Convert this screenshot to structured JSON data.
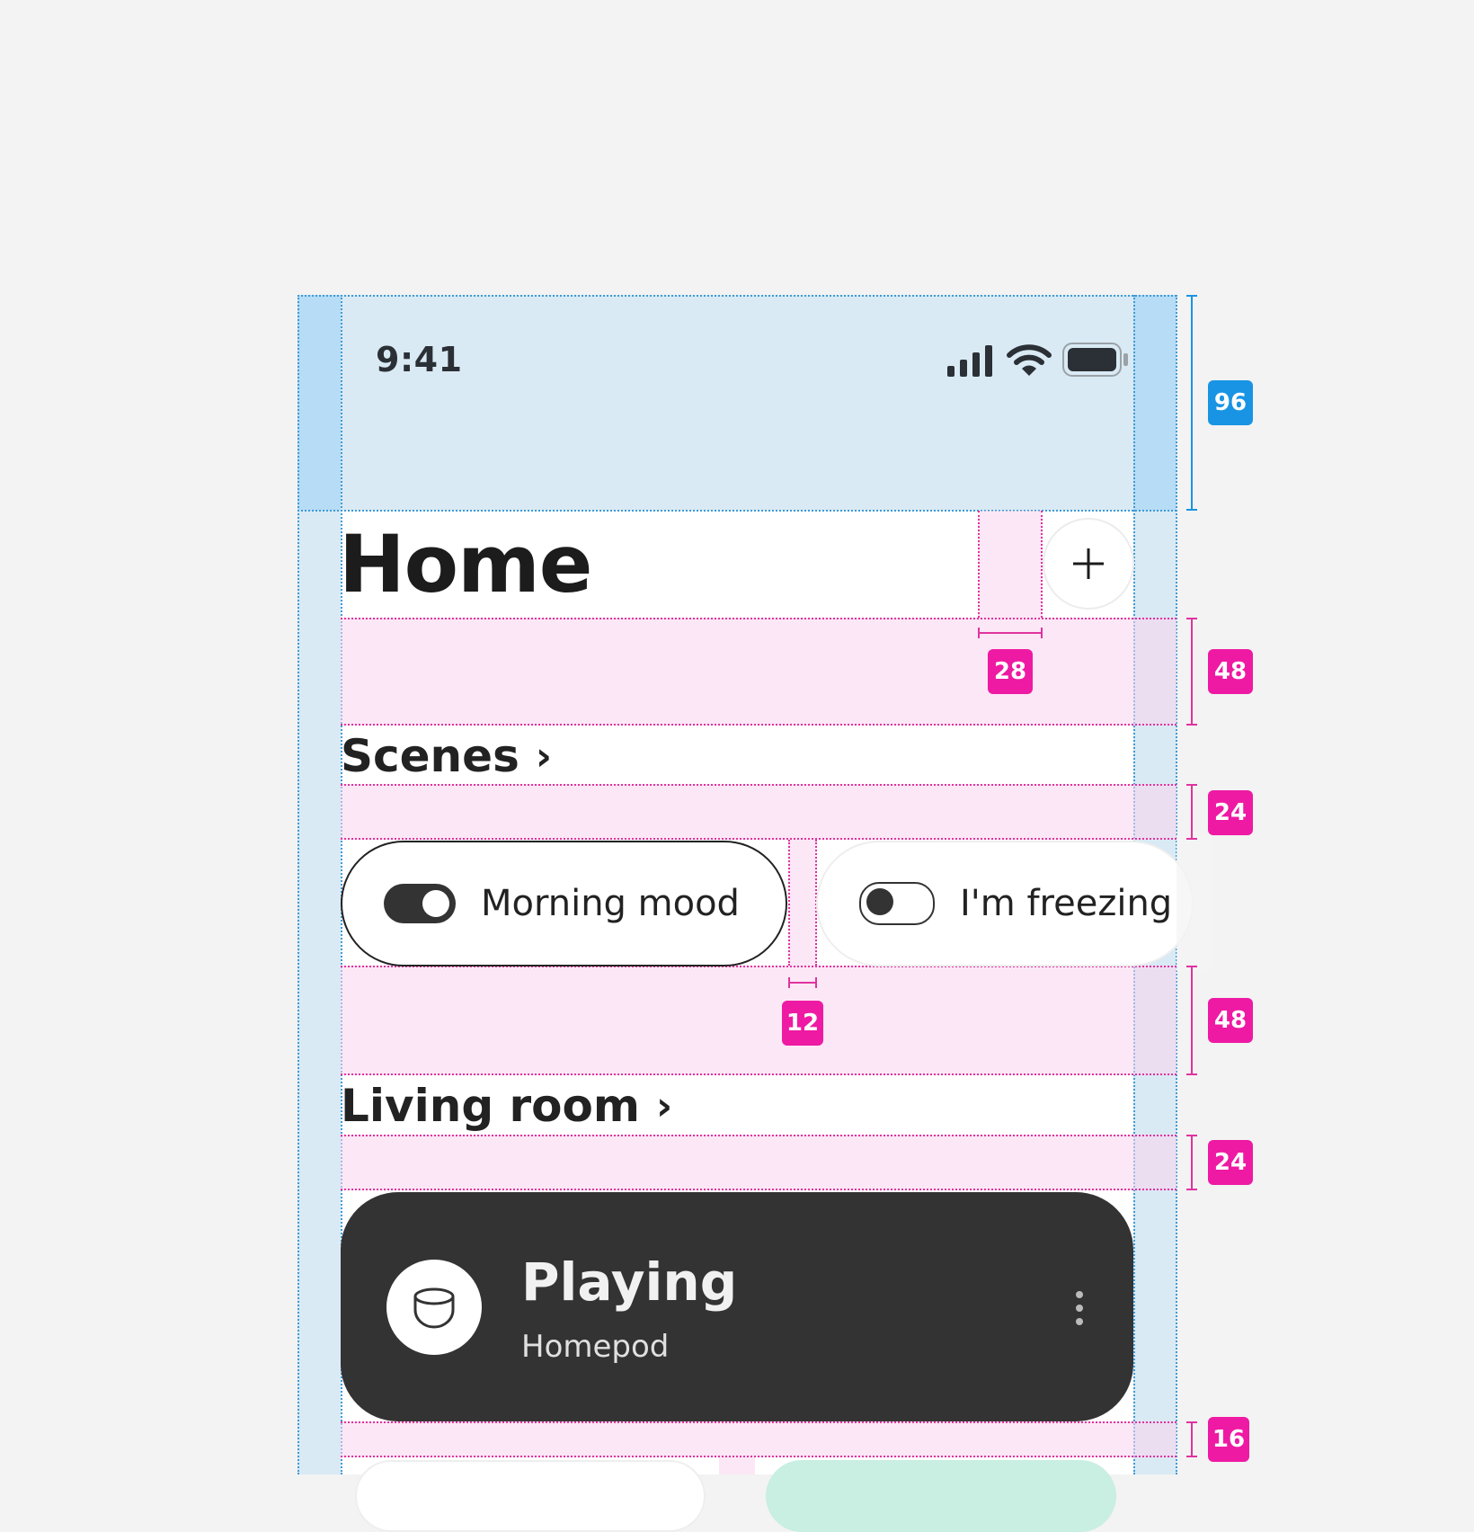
{
  "status_bar": {
    "time": "9:41",
    "icons": [
      "signal-icon",
      "wifi-icon",
      "battery-icon"
    ]
  },
  "header": {
    "title": "Home",
    "add_button_icon": "plus-icon"
  },
  "scenes": {
    "title": "Scenes",
    "items": [
      {
        "label": "Morning mood",
        "enabled": true
      },
      {
        "label": "I'm freezing",
        "enabled": false
      }
    ]
  },
  "living_room": {
    "title": "Living room",
    "device": {
      "status": "Playing",
      "name": "Homepod",
      "icon": "homepod-icon"
    }
  },
  "spec": {
    "status_height": "96",
    "title_gap": "48",
    "button_gap": "28",
    "scenes_gap": "24",
    "chip_gap": "12",
    "section_gap": "48",
    "living_gap": "24",
    "card_gap": "16"
  },
  "colors": {
    "background": "#f3f3f3",
    "dark_card": "#333333",
    "spec_pink": "#ee1aa3",
    "spec_blue": "#1994e4",
    "mint": "#c9eee2"
  }
}
